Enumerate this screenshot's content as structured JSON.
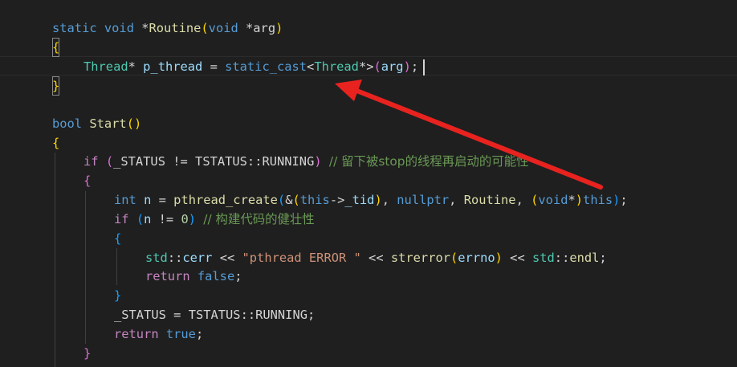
{
  "code": {
    "line1": {
      "static": "static",
      "void": "void",
      "star": " *",
      "fname": "Routine",
      "open": "(",
      "void2": "void",
      "param": " *arg",
      "close": ")"
    },
    "line2": {
      "brace": "{"
    },
    "line3": {
      "type": "Thread",
      "star": "* ",
      "var": "p_thread",
      "eq": " = ",
      "cast": "static_cast",
      "lt": "<",
      "type2": "Thread",
      "gt": "*>",
      "open": "(",
      "arg": "arg",
      "close": ")",
      "semi": ";"
    },
    "line4": {
      "brace": "}"
    },
    "line5": {
      "type": "bool",
      "fname": "Start",
      "parens": "()"
    },
    "line6": {
      "brace": "{"
    },
    "line7": {
      "kw": "if",
      "open": " (",
      "status": "_STATUS",
      "neq": " != ",
      "ns": "TSTATUS",
      "sep": "::",
      "running": "RUNNING",
      "close": ")",
      "comment": "// 留下被stop的线程再启动的可能性"
    },
    "line8": {
      "brace": "{"
    },
    "line9": {
      "int": "int",
      "var": " n",
      "eq": " = ",
      "fname": "pthread_create",
      "open1": "(",
      "amp": "&",
      "open2": "(",
      "this": "this",
      "arrow": "->",
      "tid": "_tid",
      "close2": ")",
      "comma1": ", ",
      "nullptr": "nullptr",
      "comma2": ", ",
      "routine": "Routine",
      "comma3": ", ",
      "open3": "(",
      "void": "void",
      "star": "*",
      "close3": ")",
      "this2": "this",
      "close1": ")",
      "semi": ";"
    },
    "line10": {
      "kw": "if",
      "open": " (",
      "var": "n",
      "neq": " != ",
      "zero": "0",
      "close": ")",
      "comment": "// 构建代码的健壮性"
    },
    "line11": {
      "brace": "{"
    },
    "line12": {
      "ns": "std",
      "sep1": "::",
      "cerr": "cerr",
      "op1": " << ",
      "str": "\"pthread ERROR \"",
      "op2": " << ",
      "fname": "strerror",
      "open": "(",
      "errno": "errno",
      "close": ")",
      "op3": " << ",
      "ns2": "std",
      "sep2": "::",
      "endl": "endl",
      "semi": ";"
    },
    "line13": {
      "kw": "return",
      "val": " false",
      "semi": ";"
    },
    "line14": {
      "brace": "}"
    },
    "line15": {
      "status": "_STATUS",
      "eq": " = ",
      "ns": "TSTATUS",
      "sep": "::",
      "running": "RUNNING",
      "semi": ";"
    },
    "line16": {
      "kw": "return",
      "val": " true",
      "semi": ";"
    },
    "line17": {
      "brace": "}"
    }
  },
  "annotation": {
    "arrow_color": "#e8231f"
  },
  "colors": {
    "background": "#1f1f1f",
    "keyword": "#569cd6",
    "control": "#c586c0",
    "function": "#dcdcaa",
    "type": "#4ec9b0",
    "variable": "#9cdcfe",
    "string": "#ce9178",
    "comment": "#6a9955",
    "bracket_gold": "#ffd700",
    "bracket_purple": "#da70d6",
    "bracket_blue": "#179fff"
  }
}
